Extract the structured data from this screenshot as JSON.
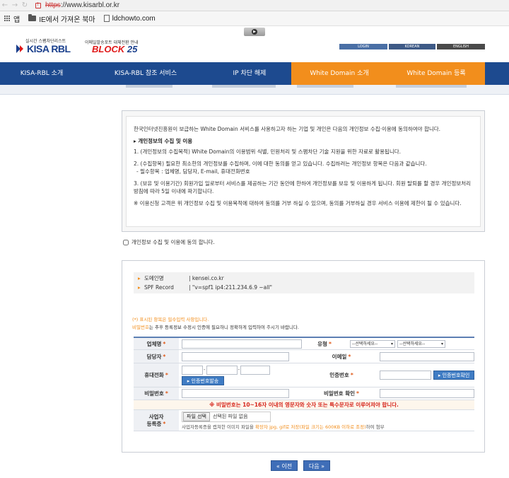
{
  "browser": {
    "url_scheme": "https",
    "url_rest": "://www.kisarbl.or.kr",
    "bookmarks": {
      "apps_label": "앱",
      "items": [
        "IE에서 가져온 북마",
        "ldchowto.com"
      ]
    }
  },
  "header": {
    "logo_sub": "실시간 스팸차단리스트",
    "logo_main": "KISA RBL",
    "block_sub": "이메일발송포트 대체전환 안내",
    "block_main": "BLOCK",
    "block_num": "25",
    "lang": [
      "LOGIN",
      "KOREAN",
      "ENGLISH"
    ]
  },
  "gnb": [
    "KISA-RBL 소개",
    "KISA-RBL 참조 서비스",
    "IP 차단 해제",
    "White Domain 소개",
    "White Domain 등록"
  ],
  "consent": {
    "intro": "한국인터넷진흥원이 보급하는 White Domain 서비스를 사용하고자 하는 기업 및 개인은 다음의 개인정보 수집·이용에 동의하여야 합니다.",
    "heading": "▸ 개인정보의 수집 및 이용",
    "p1": "1. (개인정보의 수집목적) White Domain의 이용범위 식별, 민원처리 및 스팸차단 기술 지원을 위한 자료로 활용됩니다.",
    "p2a": "2. (수집항목) 필요한 최소한의 개인정보를 수집하며, 이에 대한 동의를 얻고 있습니다. 수집하려는 개인정보 항목은 다음과 같습니다.",
    "p2b": "- 필수항목 : 업체명, 담당자, E-mail, 휴대전화번호",
    "p3": "3. (보유 및 이용기간) 회원가입 일로부터 서비스를 제공하는 기간 동안에 한하여 개인정보를 보유 및 이용하게 됩니다. 회원 탈퇴를 할 경우 개인정보처리방침에 따라 5일 이내에 파기합니다.",
    "p4": "※ 이용신청 고객은 위 개인정보 수집 및 이용목적에 대하여 동의를 거부 하실 수 있으며, 동의를 거부하실 경우 서비스 이용에 제한이 될 수 있습니다.",
    "agree_label": "개인정보 수집 및 이용에 동의 합니다."
  },
  "domain_info": {
    "domain_label": "도메인명",
    "domain_value": "| kensei.co.kr",
    "spf_label": "SPF Record",
    "spf_value": "| \"v=spf1 ip4:211.234.6.9 ~all\""
  },
  "notice": {
    "line1": "(*) 표시된 항목은 필수입력 사항입니다.",
    "line2_em": "비밀번호",
    "line2_rest": "는 추후 등록정보 수정시 인증에 필요하니 정확하게 입력하여 주시기 바랍니다."
  },
  "form": {
    "company": "업체명",
    "type": "유형",
    "select1": "--선택하세요--",
    "select2": "--선택하세요--",
    "manager": "담당자",
    "email": "이메일",
    "phone": "휴대전화",
    "send_code": "인증번호발송",
    "auth_code": "인증번호",
    "confirm_code": "인증번호확인",
    "password": "비밀번호",
    "password_confirm": "비밀번호 확인",
    "password_rule": "※ 비밀번호는 10~16자 이내의 영문자와 숫자 또는 특수문자로 이루어져야 합니다.",
    "biz_label_1": "사업자",
    "biz_label_2": "등록증",
    "file_button": "파일 선택",
    "file_none": "선택된 파일 없음",
    "file_help_a": "사업자등록증을 캡쳐한 이미지 파일을 ",
    "file_help_b": "확장자 jpg, gif로 저장(파일 크기는 600KB 이하로 조정)",
    "file_help_c": "하여 첨부"
  },
  "buttons": {
    "prev": "« 이전",
    "next": "다음 »"
  },
  "colors": {
    "nav_blue": "#1d4a8f",
    "nav_orange": "#f28e1c",
    "warning_red": "#d6261c"
  }
}
